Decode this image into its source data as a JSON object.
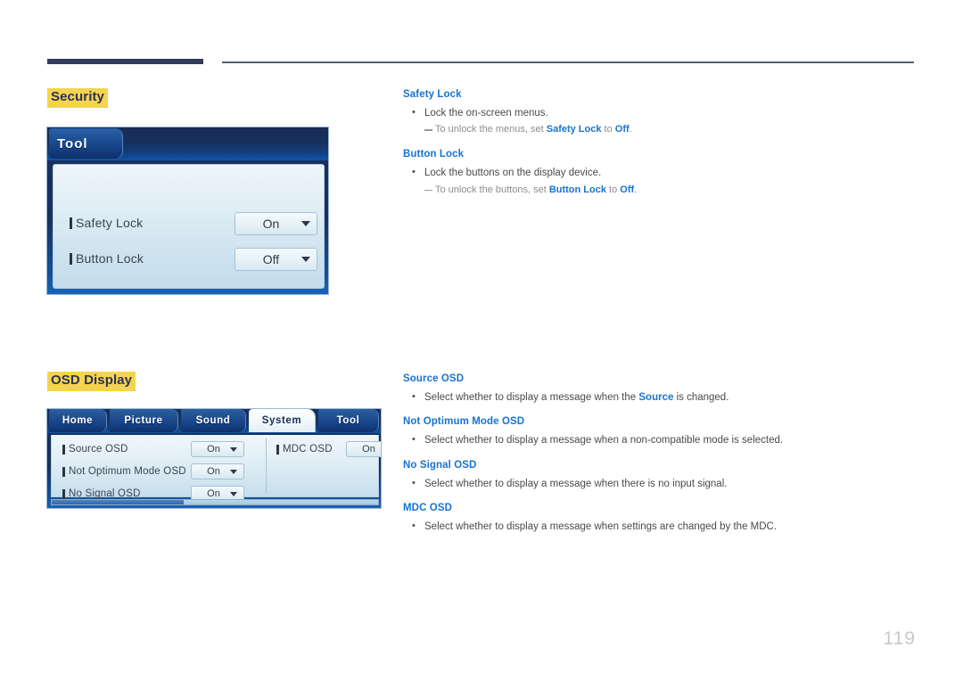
{
  "page": {
    "number": "119"
  },
  "sections": [
    {
      "heading": "Security",
      "panel": {
        "tab_label": "Tool",
        "rows": [
          {
            "label": "Safety Lock",
            "value": "On"
          },
          {
            "label": "Button Lock",
            "value": "Off"
          }
        ]
      }
    },
    {
      "heading": "OSD Display",
      "panel": {
        "tabs": [
          {
            "label": "Home",
            "active": false
          },
          {
            "label": "Picture",
            "active": false
          },
          {
            "label": "Sound",
            "active": false
          },
          {
            "label": "System",
            "active": true
          },
          {
            "label": "Tool",
            "active": false
          }
        ],
        "left_rows": [
          {
            "label": "Source OSD",
            "value": "On"
          },
          {
            "label": "Not Optimum Mode OSD",
            "value": "On"
          },
          {
            "label": "No Signal OSD",
            "value": "On"
          }
        ],
        "right_rows": [
          {
            "label": "MDC OSD",
            "value": "On"
          }
        ]
      }
    }
  ],
  "doc_security": {
    "term_1": "Safety Lock",
    "bullet_1": "Lock the on-screen menus.",
    "note_1_pre": "To unlock the menus, set ",
    "note_1_bold_1": "Safety Lock",
    "note_1_mid": " to ",
    "note_1_bold_2": "Off",
    "note_1_post": ".",
    "term_2": "Button Lock",
    "bullet_2": "Lock the buttons on the display device.",
    "note_2_pre": "To unlock the buttons, set ",
    "note_2_bold_1": "Button Lock",
    "note_2_mid": " to ",
    "note_2_bold_2": "Off",
    "note_2_post": "."
  },
  "doc_osd": {
    "term_1": "Source OSD",
    "bullet_1_pre": "Select whether to display a message when the ",
    "bullet_1_bold": "Source",
    "bullet_1_post": " is changed.",
    "term_2": "Not Optimum Mode OSD",
    "bullet_2": "Select whether to display a message when a non-compatible mode is selected.",
    "term_3": "No Signal OSD",
    "bullet_3": "Select whether to display a message when there is no input signal.",
    "term_4": "MDC OSD",
    "bullet_4": "Select whether to display a message when settings are changed by the MDC."
  },
  "colors": {
    "heading_highlight": "#f4d44e",
    "heading_text": "#2b3259",
    "doc_term_blue": "#1773d2",
    "rule_dark": "#333b5e",
    "page_number_gray": "#c9c9c9"
  }
}
